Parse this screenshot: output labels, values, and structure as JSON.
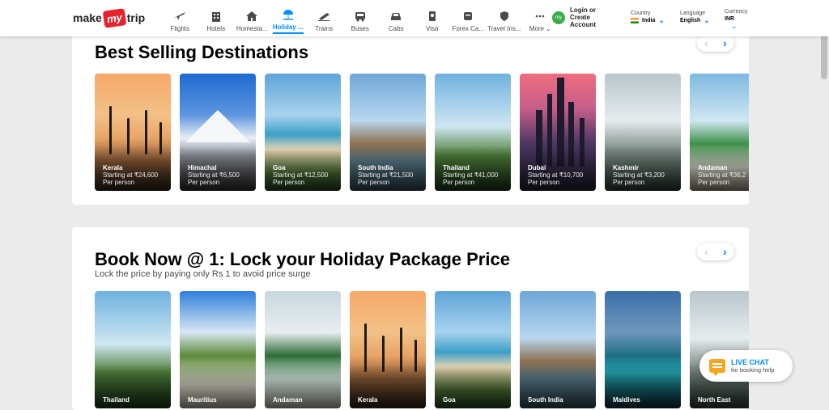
{
  "header": {
    "logo": {
      "make": "make",
      "my": "my",
      "trip": "trip"
    },
    "nav": [
      {
        "label": "Flights",
        "icon": "plane-icon",
        "active": false
      },
      {
        "label": "Hotels",
        "icon": "hotel-icon",
        "active": false
      },
      {
        "label": "Homesta...",
        "icon": "homestay-icon",
        "active": false
      },
      {
        "label": "Holiday ...",
        "icon": "holiday-icon",
        "active": true
      },
      {
        "label": "Trains",
        "icon": "train-icon",
        "active": false
      },
      {
        "label": "Buses",
        "icon": "bus-icon",
        "active": false
      },
      {
        "label": "Cabs",
        "icon": "cab-icon",
        "active": false
      },
      {
        "label": "Visa",
        "icon": "visa-icon",
        "active": false
      },
      {
        "label": "Forex Ca...",
        "icon": "forex-icon",
        "active": false
      },
      {
        "label": "Travel Ins...",
        "icon": "insurance-icon",
        "active": false
      }
    ],
    "more_label": "More",
    "login": {
      "avatar_text": "my",
      "line1": "Login or",
      "line2": "Create",
      "line3": "Account"
    },
    "country": {
      "label": "Country",
      "value": "India"
    },
    "language": {
      "label": "Language",
      "value": "English"
    },
    "currency": {
      "label": "Currency",
      "value": "INR"
    }
  },
  "best_selling": {
    "title": "Best Selling Destinations",
    "items": [
      {
        "name": "Kerala",
        "price": "Starting at ₹24,600",
        "per": "Per person",
        "scene": "sunset"
      },
      {
        "name": "Himachal",
        "price": "Starting at ₹6,500",
        "per": "Per person",
        "scene": "mountain"
      },
      {
        "name": "Goa",
        "price": "Starting at ₹12,500",
        "per": "Per person",
        "scene": "beach"
      },
      {
        "name": "South India",
        "price": "Starting at ₹21,500",
        "per": "Per person",
        "scene": "temple"
      },
      {
        "name": "Thailand",
        "price": "Starting at ₹41,000",
        "per": "Per person",
        "scene": "cliff"
      },
      {
        "name": "Dubai",
        "price": "Starting at ₹10,700",
        "per": "Per person",
        "scene": "city"
      },
      {
        "name": "Kashmir",
        "price": "Starting at ₹3,200",
        "per": "Per person",
        "scene": "snow"
      },
      {
        "name": "Andaman",
        "price": "Starting at ₹36,2",
        "per": "Per person",
        "scene": "island"
      }
    ]
  },
  "book_now": {
    "title": "Book Now @ 1: Lock your Holiday Package Price",
    "subtitle": "Lock the price by paying only Rs 1 to avoid price surge",
    "items": [
      {
        "name": "Thailand",
        "scene": "cliff"
      },
      {
        "name": "Mauritius",
        "scene": "mauritius"
      },
      {
        "name": "Andaman",
        "scene": "island2"
      },
      {
        "name": "Kerala",
        "scene": "sunset"
      },
      {
        "name": "Goa",
        "scene": "beach"
      },
      {
        "name": "South India",
        "scene": "temple"
      },
      {
        "name": "Maldives",
        "scene": "maldives"
      },
      {
        "name": "North East",
        "scene": "snow"
      }
    ]
  },
  "live_chat": {
    "title": "LIVE CHAT",
    "subtitle": "for booking help"
  },
  "colors": {
    "accent": "#008cff",
    "brand_red": "#e7242d",
    "chat": "#f5a623"
  }
}
